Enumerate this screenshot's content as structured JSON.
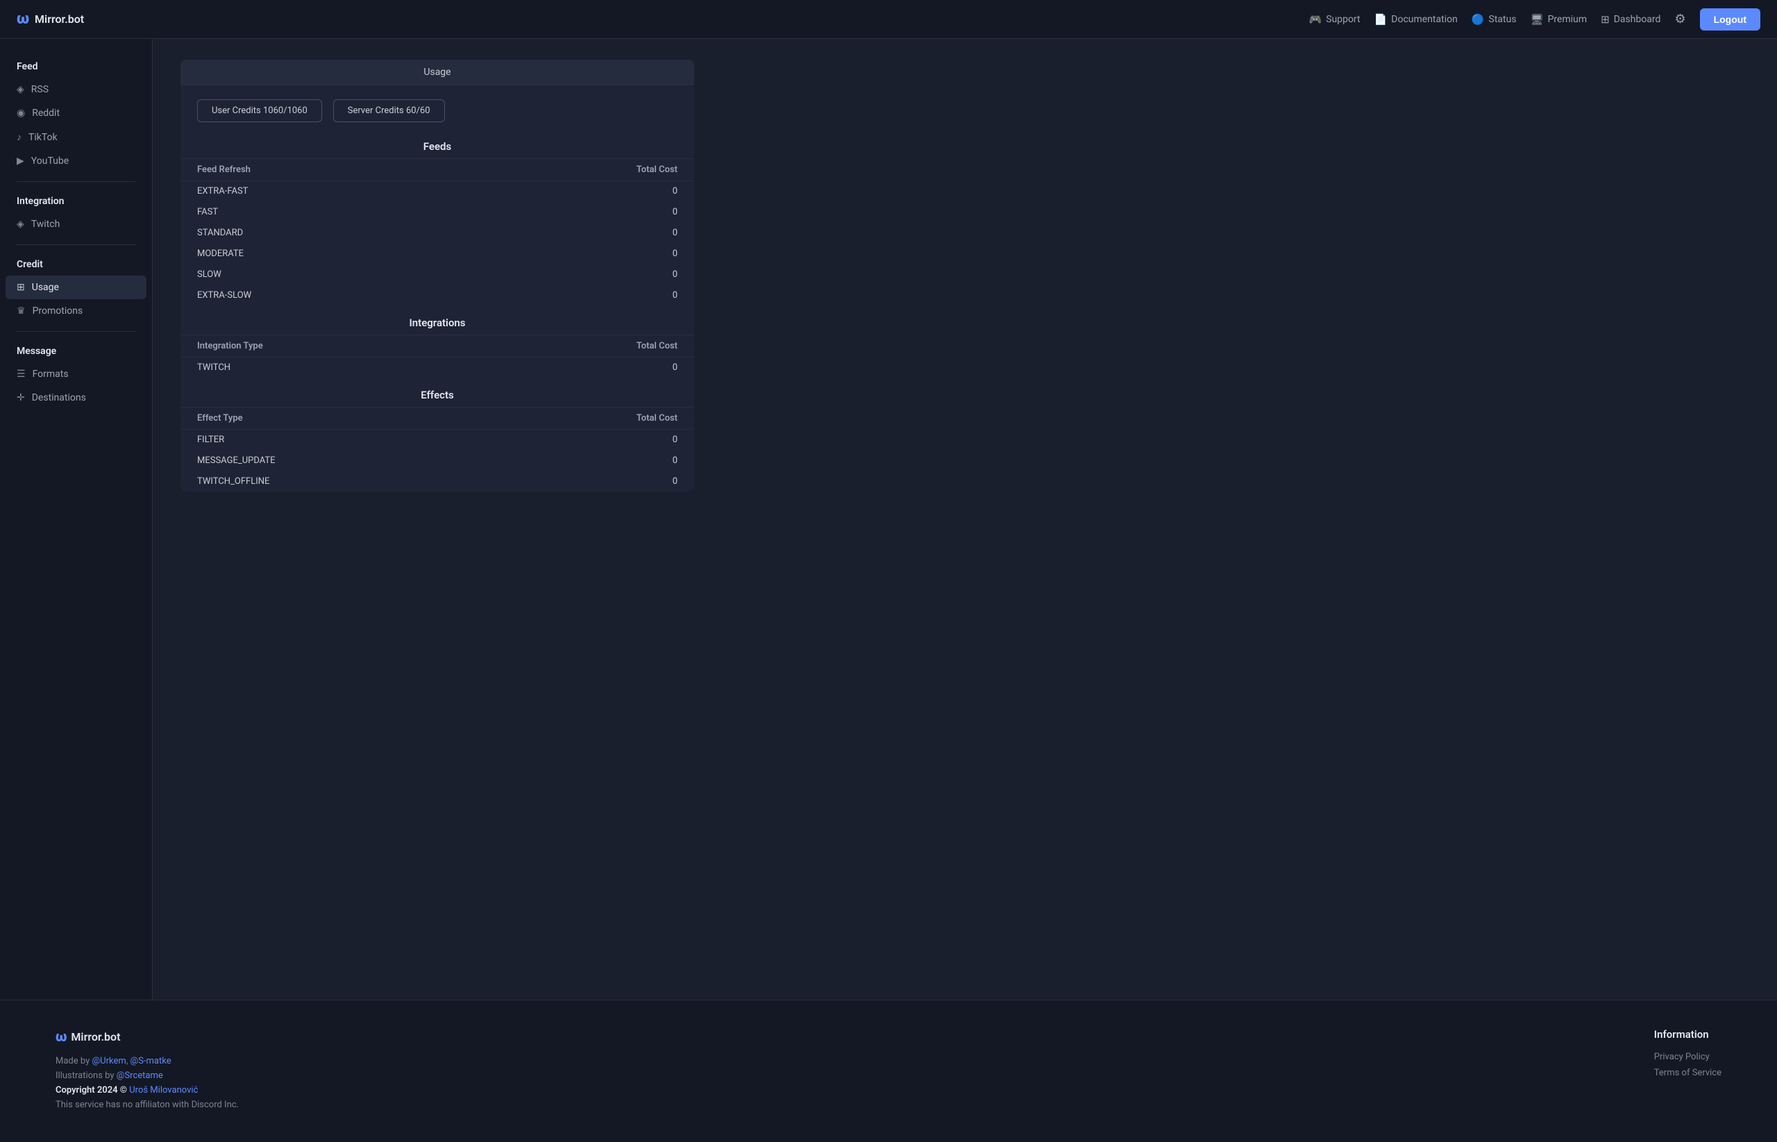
{
  "header": {
    "logo_icon": "ω",
    "logo_text": "Mirror.bot",
    "nav": [
      {
        "key": "support",
        "label": "Support",
        "icon": "🎮"
      },
      {
        "key": "documentation",
        "label": "Documentation",
        "icon": "📄"
      },
      {
        "key": "status",
        "label": "Status",
        "icon": "🔵"
      },
      {
        "key": "premium",
        "label": "Premium",
        "icon": "🖥"
      },
      {
        "key": "dashboard",
        "label": "Dashboard",
        "icon": "⊞"
      }
    ],
    "logout_label": "Logout"
  },
  "sidebar": {
    "sections": [
      {
        "label": "Feed",
        "items": [
          {
            "key": "rss",
            "label": "RSS",
            "icon": "◈"
          },
          {
            "key": "reddit",
            "label": "Reddit",
            "icon": "◉"
          },
          {
            "key": "tiktok",
            "label": "TikTok",
            "icon": "♪"
          },
          {
            "key": "youtube",
            "label": "YouTube",
            "icon": "▶"
          }
        ]
      },
      {
        "label": "Integration",
        "items": [
          {
            "key": "twitch",
            "label": "Twitch",
            "icon": "◈"
          }
        ]
      },
      {
        "label": "Credit",
        "items": [
          {
            "key": "usage",
            "label": "Usage",
            "icon": "⊞",
            "active": true
          },
          {
            "key": "promotions",
            "label": "Promotions",
            "icon": "♛"
          }
        ]
      },
      {
        "label": "Message",
        "items": [
          {
            "key": "formats",
            "label": "Formats",
            "icon": "☰"
          },
          {
            "key": "destinations",
            "label": "Destinations",
            "icon": "✛"
          }
        ]
      }
    ]
  },
  "main": {
    "usage_title": "Usage",
    "user_credits_label": "User Credits 1060/1060",
    "server_credits_label": "Server Credits 60/60",
    "feeds_title": "Feeds",
    "feeds_col1": "Feed Refresh",
    "feeds_col2": "Total Cost",
    "feeds_rows": [
      {
        "type": "EXTRA-FAST",
        "cost": "0"
      },
      {
        "type": "FAST",
        "cost": "0"
      },
      {
        "type": "STANDARD",
        "cost": "0"
      },
      {
        "type": "MODERATE",
        "cost": "0"
      },
      {
        "type": "SLOW",
        "cost": "0"
      },
      {
        "type": "EXTRA-SLOW",
        "cost": "0"
      }
    ],
    "integrations_title": "Integrations",
    "integrations_col1": "Integration Type",
    "integrations_col2": "Total Cost",
    "integrations_rows": [
      {
        "type": "TWITCH",
        "cost": "0"
      }
    ],
    "effects_title": "Effects",
    "effects_col1": "Effect Type",
    "effects_col2": "Total Cost",
    "effects_rows": [
      {
        "type": "FILTER",
        "cost": "0"
      },
      {
        "type": "MESSAGE_UPDATE",
        "cost": "0"
      },
      {
        "type": "TWITCH_OFFLINE",
        "cost": "0"
      }
    ]
  },
  "footer": {
    "logo_icon": "ω",
    "logo_text": "Mirror.bot",
    "made_by_prefix": "Made by ",
    "made_by_links": [
      "@Urkem",
      "@S-matke"
    ],
    "illustrations_prefix": "Illustrations by ",
    "illustrations_link": "@Srcetame",
    "copyright": "Copyright 2024 © ",
    "copyright_author": "Uroš Milovanović",
    "disclaimer": "This service has no affiliaton with Discord Inc.",
    "info_title": "Information",
    "info_links": [
      {
        "key": "privacy",
        "label": "Privacy Policy"
      },
      {
        "key": "terms",
        "label": "Terms of Service"
      }
    ]
  }
}
